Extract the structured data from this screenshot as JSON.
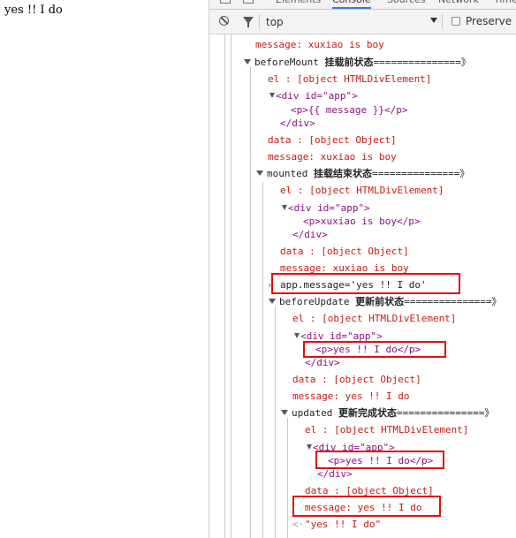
{
  "page": {
    "text": "yes !! I do"
  },
  "devtools": {
    "tabs": [
      "Elements",
      "Console",
      "Sources",
      "Network",
      "Time"
    ],
    "active_tab": "Console",
    "toolbar": {
      "context": "top",
      "preserve_log": "Preserve lo"
    },
    "console": {
      "message_top": "message: xuxiao is boy",
      "before_mount": {
        "label": "beforeMount",
        "zh": "挂载前状态",
        "rule": "===============》"
      },
      "bm_el": "el     : [object HTMLDivElement]",
      "bm_div_open": "<div id=\"app\">",
      "bm_p": "<p>{{ message }}</p>",
      "bm_div_close": "</div>",
      "bm_data": "data   : [object Object]",
      "bm_message": "message: xuxiao is boy",
      "mounted": {
        "label": "mounted",
        "zh": "挂载结束状态",
        "rule": "===============》"
      },
      "m_el": "el     : [object HTMLDivElement]",
      "m_div_open": "<div id=\"app\">",
      "m_p": "<p>xuxiao is boy</p>",
      "m_div_close": "</div>",
      "m_data": "data   : [object Object]",
      "m_message": "message: xuxiao is boy",
      "command": "app.message='yes !! I do'",
      "before_update": {
        "label": "beforeUpdate",
        "zh": "更新前状态",
        "rule": "===============》"
      },
      "bu_el": "el     : [object HTMLDivElement]",
      "bu_div_open": "<div id=\"app\">",
      "bu_p": "<p>yes !! I do</p>",
      "bu_div_close": "</div>",
      "bu_data": "data   : [object Object]",
      "bu_message": "message: yes !! I do",
      "updated": {
        "label": "updated",
        "zh": "更新完成状态",
        "rule": "===============》"
      },
      "u_el": "el     : [object HTMLDivElement]",
      "u_div_open": "<div id=\"app\">",
      "u_p": "<p>yes !! I do</p>",
      "u_div_close": "</div>",
      "u_data": "data   : [object Object]",
      "u_message": "message: yes !! I do",
      "result": "\"yes !! I do\""
    }
  },
  "colors": {
    "highlight": "#e01010",
    "log_red": "#c41a16",
    "tag": "#881280",
    "prompt": "#2f6fe0"
  },
  "icons": [
    "clear-console-icon",
    "filter-icon",
    "dropdown-arrow-icon",
    "expand-triangle-icon",
    "prompt-chevron-icon",
    "return-arrow-icon"
  ]
}
